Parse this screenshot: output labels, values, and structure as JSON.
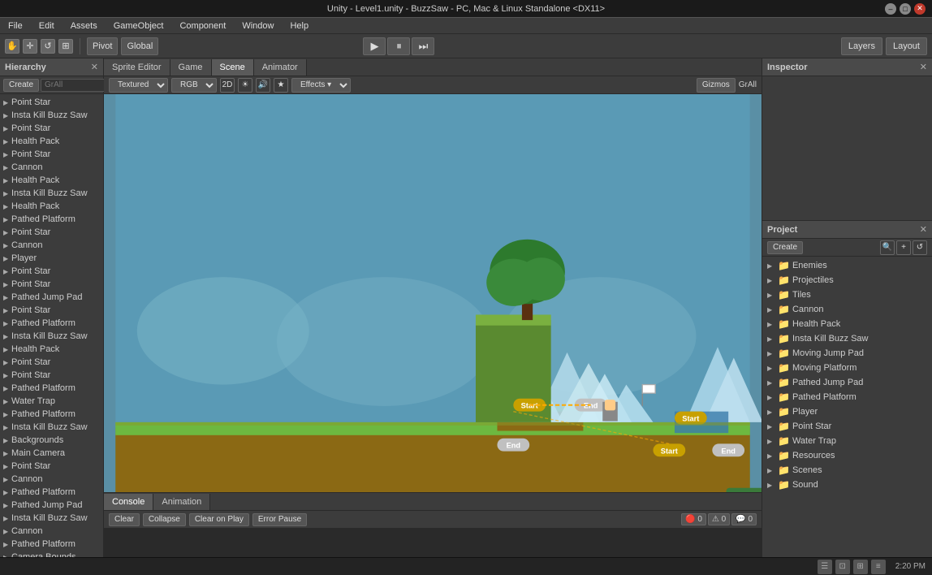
{
  "titlebar": {
    "title": "Unity - Level1.unity - BuzzSaw - PC, Mac & Linux Standalone <DX11>"
  },
  "menubar": {
    "items": [
      "File",
      "Edit",
      "Assets",
      "GameObject",
      "Component",
      "Window",
      "Help"
    ]
  },
  "toolbar": {
    "pivot_label": "Pivot",
    "global_label": "Global",
    "layers_label": "Layers",
    "layout_label": "Layout"
  },
  "tabs": {
    "sprite_editor": "Sprite Editor",
    "game": "Game",
    "scene": "Scene",
    "animator": "Animator"
  },
  "scene_toolbar": {
    "textured": "Textured",
    "rgb": "RGB",
    "view2d": "2D",
    "effects": "Effects",
    "gizmos": "Gizmos",
    "all": "All"
  },
  "hierarchy": {
    "title": "Hierarchy",
    "create_label": "Create",
    "search_placeholder": "GrAll",
    "items": [
      "Point Star",
      "Insta Kill Buzz Saw",
      "Point Star",
      "Health Pack",
      "Point Star",
      "Cannon",
      "Health Pack",
      "Insta Kill Buzz Saw",
      "Health Pack",
      "Pathed Platform",
      "Point Star",
      "Cannon",
      "Player",
      "Point Star",
      "Point Star",
      "Pathed Jump Pad",
      "Point Star",
      "Pathed Platform",
      "Insta Kill Buzz Saw",
      "Health Pack",
      "Point Star",
      "Point Star",
      "Pathed Platform",
      "Water Trap",
      "Pathed Platform",
      "Insta Kill Buzz Saw",
      "Backgrounds",
      "Main Camera",
      "Point Star",
      "Cannon",
      "Pathed Platform",
      "Pathed Jump Pad",
      "Insta Kill Buzz Saw",
      "Cannon",
      "Pathed Platform",
      "Camera Bounds"
    ]
  },
  "console": {
    "title": "Console",
    "animation_title": "Animation",
    "clear_label": "Clear",
    "collapse_label": "Collapse",
    "clear_on_play_label": "Clear on Play",
    "error_pause_label": "Error Pause",
    "error_count": "0",
    "warning_count": "0",
    "message_count": "0"
  },
  "inspector": {
    "title": "Inspector"
  },
  "project": {
    "title": "Project",
    "create_label": "Create",
    "folders": [
      {
        "name": "Enemies",
        "expanded": false
      },
      {
        "name": "Projectiles",
        "expanded": false
      },
      {
        "name": "Tiles",
        "expanded": false
      },
      {
        "name": "Cannon",
        "expanded": false
      },
      {
        "name": "Health Pack",
        "expanded": false
      },
      {
        "name": "Insta Kill Buzz Saw",
        "expanded": false
      },
      {
        "name": "Moving Jump Pad",
        "expanded": false
      },
      {
        "name": "Moving Platform",
        "expanded": false
      },
      {
        "name": "Pathed Jump Pad",
        "expanded": false
      },
      {
        "name": "Pathed Platform",
        "expanded": false
      },
      {
        "name": "Player",
        "expanded": false
      },
      {
        "name": "Point Star",
        "expanded": false
      },
      {
        "name": "Water Trap",
        "expanded": false
      },
      {
        "name": "Resources",
        "expanded": false
      },
      {
        "name": "Scenes",
        "expanded": false
      },
      {
        "name": "Sound",
        "expanded": false
      }
    ]
  },
  "statusbar": {
    "time": "2:20 PM",
    "icons": [
      "☰",
      "≡",
      "⊡",
      "⊞"
    ]
  },
  "colors": {
    "accent_blue": "#2a4a7a",
    "folder_yellow": "#c8a000",
    "sky_blue": "#5a8fa5",
    "ground_brown": "#8B6914",
    "platform_gray": "#888",
    "tree_green": "#2d7a2d"
  }
}
